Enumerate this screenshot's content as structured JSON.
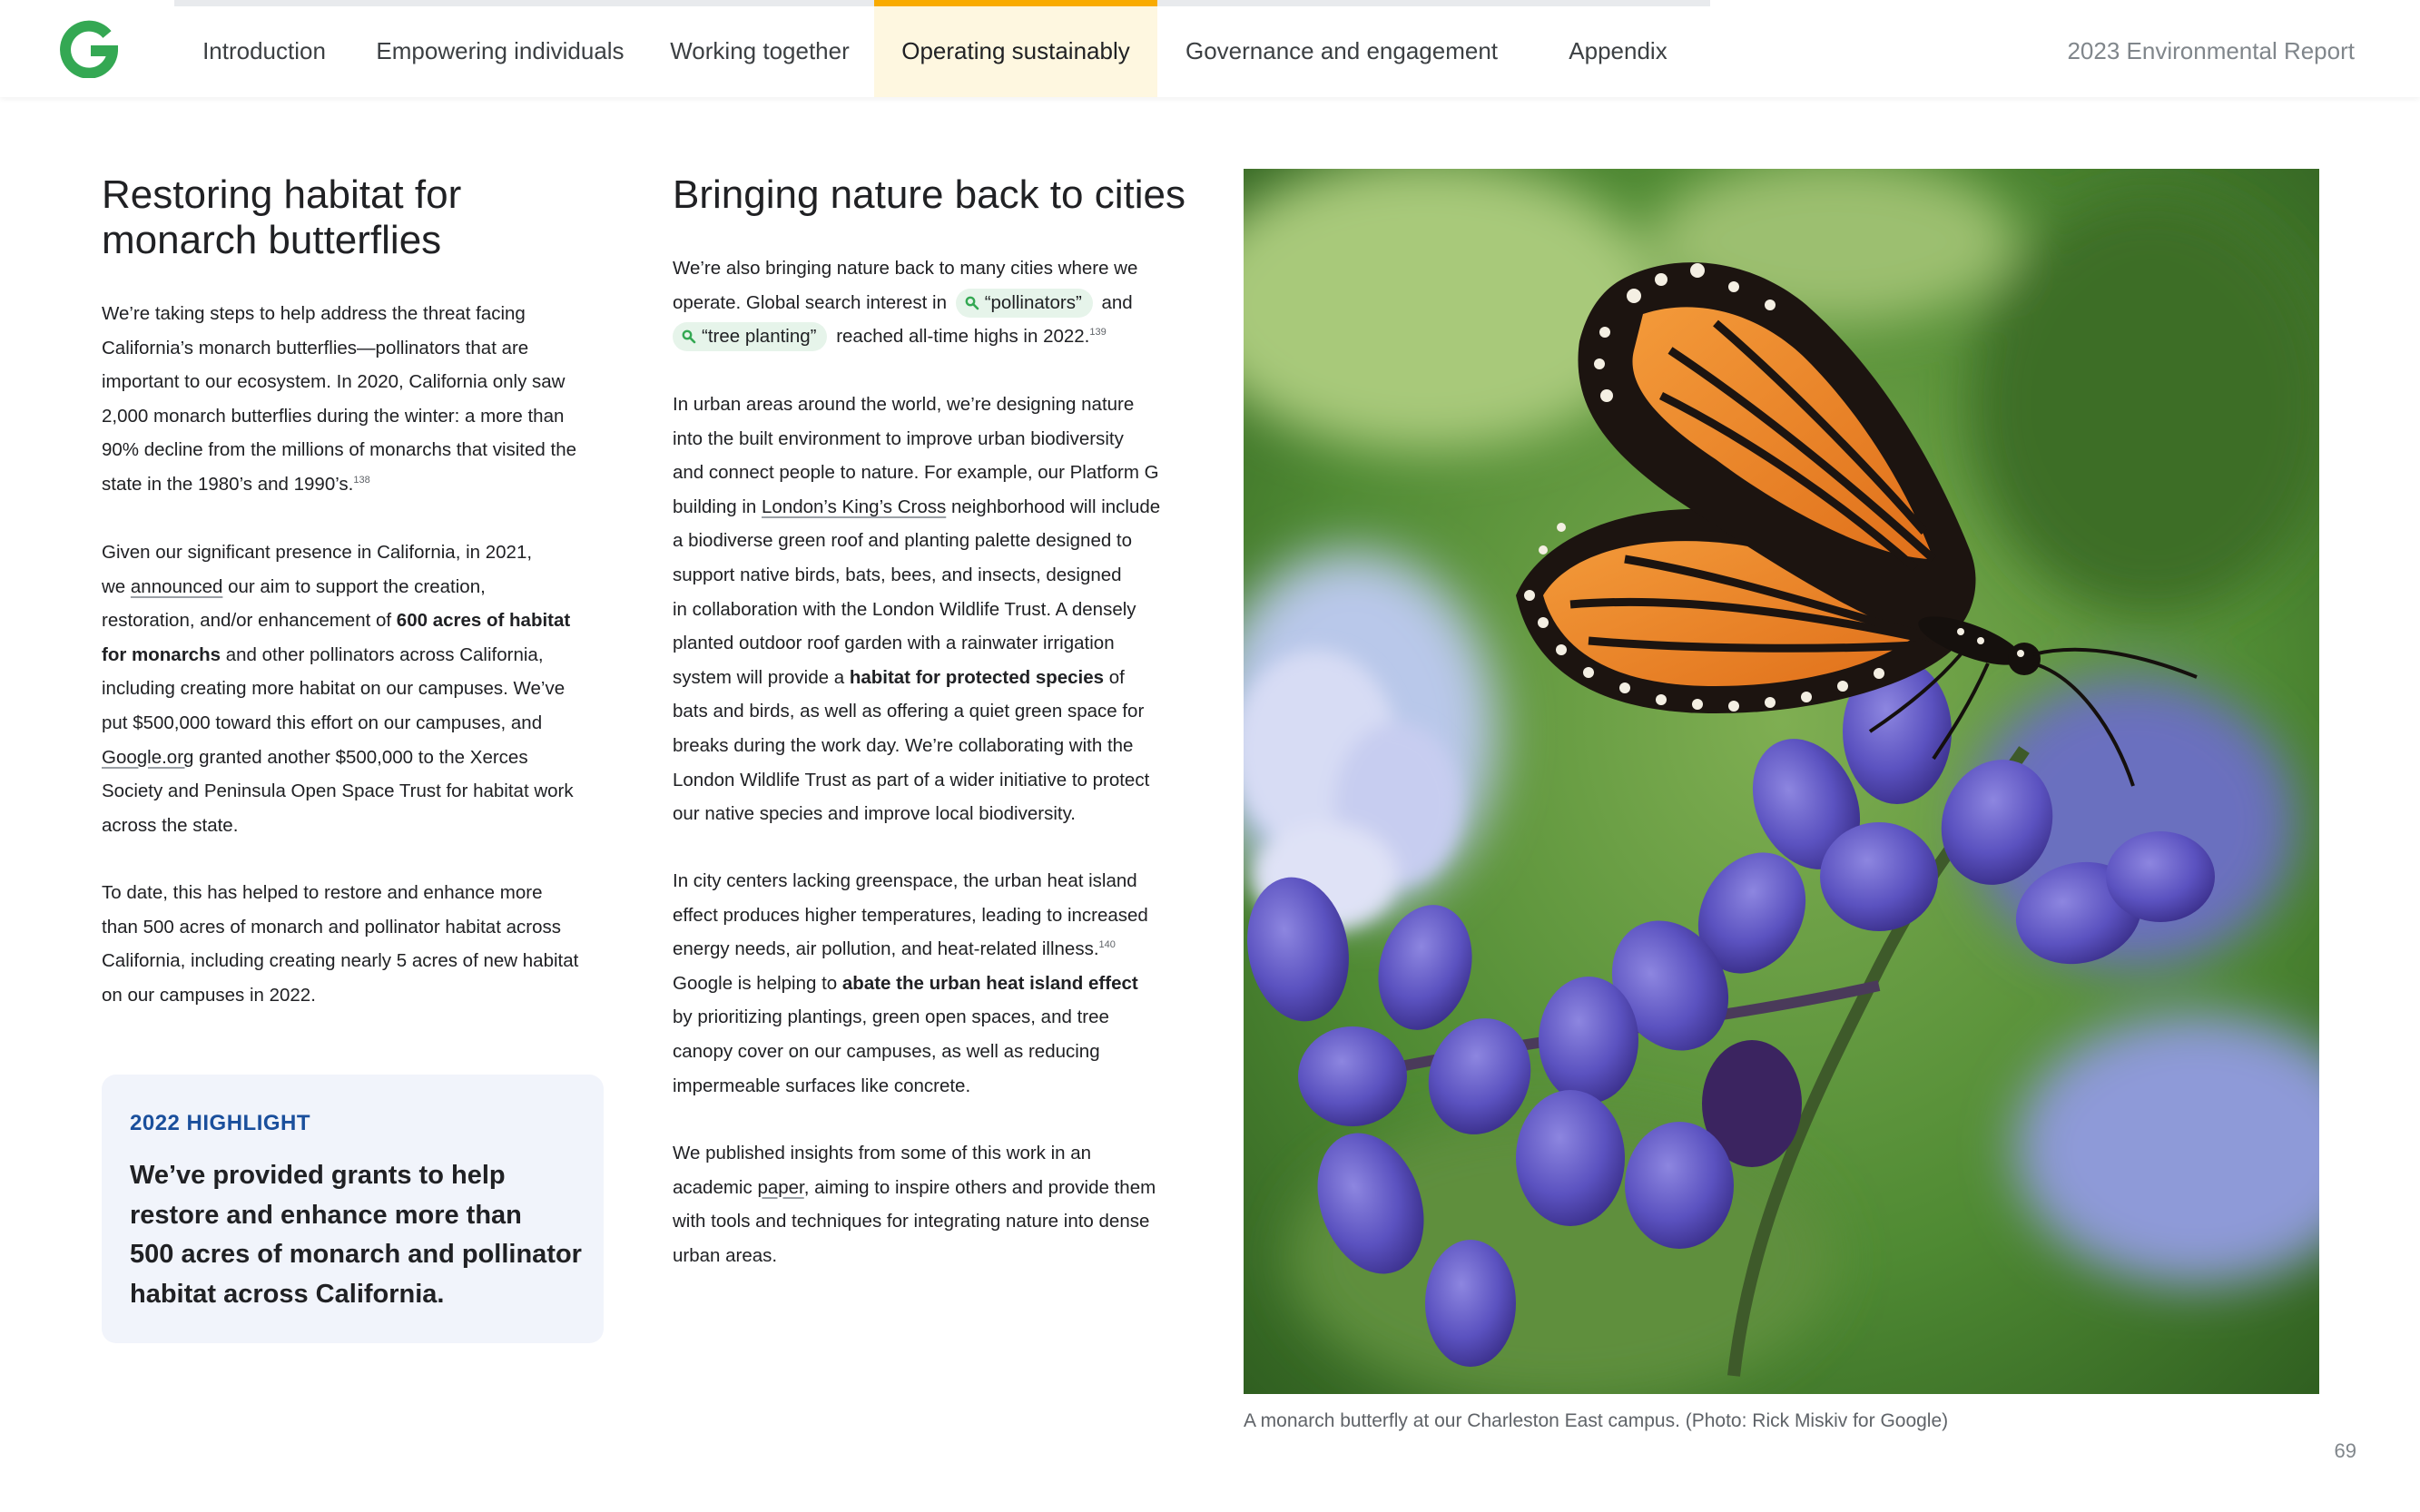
{
  "nav": {
    "tabs": [
      {
        "label": "Introduction"
      },
      {
        "label": "Empowering individuals"
      },
      {
        "label": "Working together"
      },
      {
        "label": "Operating sustainably",
        "active": true
      },
      {
        "label": "Governance and engagement"
      },
      {
        "label": "Appendix"
      }
    ],
    "report_title": "2023 Environmental Report"
  },
  "colors": {
    "accent": "#f9ab00",
    "active_tab_bg": "#fef7e0",
    "highlight_bg": "#f1f4fb",
    "highlight_label": "#1a4f9c",
    "chip_bg": "#e6f4ea",
    "logo_green": "#34a853"
  },
  "left": {
    "heading_line1": "Restoring habitat for",
    "heading_line2": "monarch butterflies",
    "p1": {
      "lines": [
        "We’re taking steps to help address the threat facing",
        "California’s monarch butterflies—pollinators that are",
        "important to our ecosystem. In 2020, California only saw",
        "2,000 monarch butterflies during the winter: a more than",
        "90% decline from the millions of monarchs that visited the"
      ],
      "last_line": "state in the 1980’s and 1990’s.",
      "footnote": "138"
    },
    "p2": {
      "l1": "Given our significant presence in California, in 2021,",
      "l2_pre": "we ",
      "l2_link": "announced",
      "l2_post": " our aim to support the creation,",
      "l3_pre": "restoration, and/or enhancement of ",
      "l3_bold": "600 acres of habitat",
      "l4_bold": "for monarchs",
      "l4_post": " and other pollinators across California,",
      "l5": "including creating more habitat on our campuses. We’ve",
      "l6": "put $500,000 toward this effort on our campuses, and",
      "l7_link": "Google.org",
      "l7_post": " granted another $500,000 to the Xerces",
      "l8": "Society and Peninsula Open Space Trust for habitat work",
      "l9": "across the state."
    },
    "p3": {
      "lines": [
        "To date, this has helped to restore and enhance more",
        "than 500 acres of monarch and pollinator habitat across",
        "California, including creating nearly 5 acres of new habitat",
        "on our campuses in 2022."
      ]
    },
    "highlight": {
      "label": "2022 HIGHLIGHT",
      "lines": [
        "We’ve provided grants to help",
        "restore and enhance more than",
        "500 acres of monarch and pollinator",
        "habitat across California."
      ]
    }
  },
  "middle": {
    "heading": "Bringing nature back to cities",
    "p1": {
      "l1": "We’re also bringing nature back to many cities where we",
      "l2_pre": "operate. Global search interest in",
      "chip1": "“pollinators”",
      "l2_post": "and",
      "chip2": "“tree planting”",
      "l3_post": "reached all-time highs in 2022.",
      "footnote": "139"
    },
    "p2": {
      "l1": "In urban areas around the world, we’re designing nature",
      "l2": "into the built environment to improve urban biodiversity",
      "l3": "and connect people to nature. For example, our Platform G",
      "l4_pre": "building in ",
      "l4_link": "London’s King’s Cross",
      "l4_post": " neighborhood will include",
      "l5": "a biodiverse green roof and planting palette designed to",
      "l6": "support native birds, bats, bees, and insects, designed",
      "l7": "in collaboration with the London Wildlife Trust. A densely",
      "l8": "planted outdoor roof garden with a rainwater irrigation",
      "l9_pre": "system will provide a ",
      "l9_bold": "habitat for protected species",
      "l9_post": " of",
      "l10": "bats and birds, as well as offering a quiet green space for",
      "l11": "breaks during the work day. We’re collaborating with the",
      "l12": "London Wildlife Trust as part of a wider initiative to protect",
      "l13": "our native species and improve local biodiversity."
    },
    "p3": {
      "l1": "In city centers lacking greenspace, the urban heat island",
      "l2": "effect produces higher temperatures, leading to increased",
      "l3": "energy needs, air pollution, and heat-related illness.",
      "footnote": "140",
      "l4_pre": "Google is helping to ",
      "l4_bold": "abate the urban heat island effect",
      "l5": "by prioritizing plantings, green open spaces, and tree",
      "l6": "canopy cover on our campuses, as well as reducing",
      "l7": "impermeable surfaces like concrete."
    },
    "p4": {
      "l1": "We published insights from some of this work in an",
      "l2_pre": "academic ",
      "l2_link": "paper",
      "l2_post": ", aiming to inspire others and provide them",
      "l3": "with tools and techniques for integrating nature into dense",
      "l4": "urban areas."
    }
  },
  "photo": {
    "caption": "A monarch butterfly at our Charleston East campus. (Photo: Rick Miskiv for Google)"
  },
  "page_number": "69"
}
